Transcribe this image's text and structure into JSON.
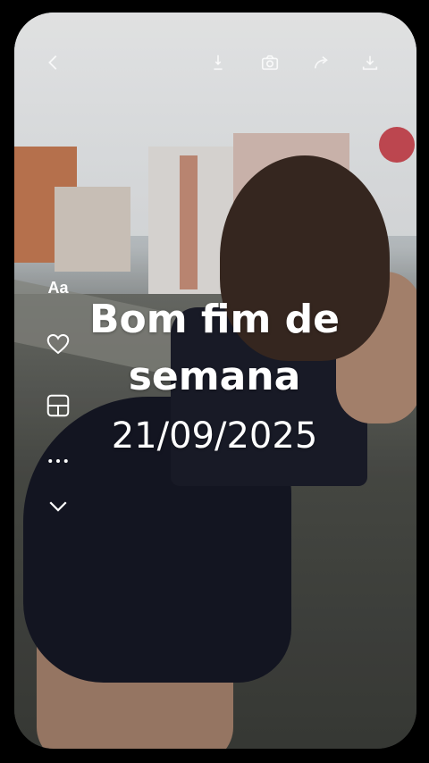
{
  "story": {
    "title": "Bom fim de semana",
    "date": "21/09/2025"
  },
  "toolbar": {
    "text_tool_label": "Aa",
    "icons": [
      "back-icon",
      "touch-icon",
      "camera-icon",
      "share-icon",
      "download-icon"
    ]
  },
  "side_tools": [
    "text-tool",
    "heart-icon",
    "layout-icon",
    "more-icon",
    "chevron-down-icon"
  ],
  "colors": {
    "text": "#ffffff",
    "frame_background": "#000000"
  }
}
